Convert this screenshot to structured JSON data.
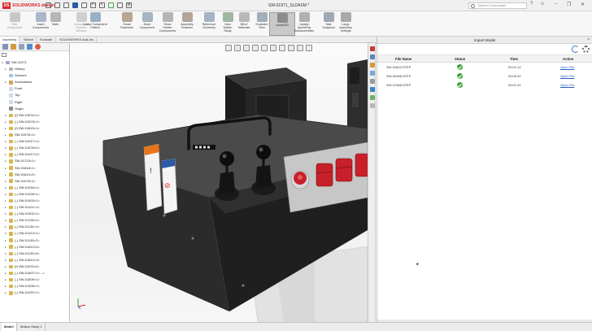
{
  "app": {
    "logo": "SOLIDWORKS design",
    "doc_title": "SW-01971_SLDASM *",
    "search_placeholder": "Search Commands"
  },
  "ribbon": [
    {
      "label": "Edit\nComponent",
      "dim": true,
      "icon": "edit-component-icon",
      "color": "#c7c7c7"
    },
    {
      "label": "Insert\nComponents",
      "icon": "insert-components-icon",
      "color": "#a9b7c9"
    },
    {
      "label": "Mate",
      "icon": "mate-icon",
      "color": "#b6b6b6"
    },
    {
      "label": "Component\nPreview\nWindow",
      "dim": true,
      "icon": "preview-window-icon",
      "color": "#cfcfcf"
    },
    {
      "label": "Linear Component\nPattern",
      "icon": "linear-pattern-icon",
      "color": "#9bb0c7"
    },
    {
      "label": "Smart\nFasteners",
      "icon": "smart-fasteners-icon",
      "color": "#b7a790"
    },
    {
      "label": "Move\nComponent",
      "icon": "move-component-icon",
      "color": "#a8b4c2"
    },
    {
      "label": "Show\nHidden\nComponents",
      "icon": "show-hidden-icon",
      "color": "#b5b5b5"
    },
    {
      "label": "Assembly\nFeatures",
      "icon": "assembly-features-icon",
      "color": "#b4a49a"
    },
    {
      "label": "Reference\nGeometry",
      "icon": "reference-geometry-icon",
      "color": "#a6b3c3"
    },
    {
      "label": "New\nMotion\nStudy",
      "icon": "motion-study-icon",
      "color": "#9fb6a3"
    },
    {
      "label": "Bill of\nMaterials",
      "icon": "bill-of-materials-icon",
      "color": "#b8b8b8"
    },
    {
      "label": "Exploded\nView",
      "icon": "exploded-view-icon",
      "color": "#a3aebb"
    },
    {
      "label": "Instant3D",
      "active": true,
      "icon": "instant3d-icon",
      "color": "#8c8c8c"
    },
    {
      "label": "Update\nSpeedPak\nSubassemblies",
      "icon": "speedpak-icon",
      "color": "#b0b0b0"
    },
    {
      "label": "Take\nSnapshot",
      "icon": "take-snapshot-icon",
      "color": "#a0a9b4"
    },
    {
      "label": "Large\nAssembly\nSettings",
      "icon": "large-assembly-icon",
      "color": "#a9a9a9"
    }
  ],
  "cmd_tabs": [
    "Assembly",
    "Sketch",
    "Evaluate",
    "SOLIDWORKS Add-Ins"
  ],
  "tree": [
    {
      "label": "SW-01971",
      "level": 0,
      "arrow": "▾",
      "icon": "assembly-icon",
      "color": "#9aa9bb"
    },
    {
      "label": "History",
      "level": 1,
      "arrow": "▸",
      "icon": "history-icon",
      "color": "#b0b0b0"
    },
    {
      "label": "Sensors",
      "level": 1,
      "arrow": "",
      "icon": "sensors-icon",
      "color": "#9ec3e0"
    },
    {
      "label": "Annotations",
      "level": 1,
      "arrow": "▸",
      "icon": "annotations-icon",
      "color": "#c9a65a"
    },
    {
      "label": "Front",
      "level": 1,
      "arrow": "",
      "icon": "plane-icon",
      "color": "#cfd9e6"
    },
    {
      "label": "Top",
      "level": 1,
      "arrow": "",
      "icon": "plane-icon",
      "color": "#cfd9e6"
    },
    {
      "label": "Right",
      "level": 1,
      "arrow": "",
      "icon": "plane-icon",
      "color": "#cfd9e6"
    },
    {
      "label": "Origin",
      "level": 1,
      "arrow": "",
      "icon": "origin-icon",
      "color": "#8c8c8c"
    },
    {
      "label": "(f) SW-01576<1>",
      "level": 1,
      "arrow": "▸",
      "icon": "part-icon",
      "color": "#d8b54a"
    },
    {
      "label": "(-) SW-01575<1>",
      "level": 1,
      "arrow": "▸",
      "icon": "part-icon",
      "color": "#d8b54a"
    },
    {
      "label": "(f) SW-01815<1>",
      "level": 1,
      "arrow": "▸",
      "icon": "part-icon",
      "color": "#d8b54a"
    },
    {
      "label": "SW-01578<1>",
      "level": 1,
      "arrow": "▸",
      "icon": "part-icon",
      "color": "#d8b54a"
    },
    {
      "label": "(-) SW-01917<1>",
      "level": 1,
      "arrow": "▸",
      "icon": "part-icon",
      "color": "#d8b54a"
    },
    {
      "label": "(-) SW-01576<2>",
      "level": 1,
      "arrow": "▸",
      "icon": "part-icon",
      "color": "#d8b54a"
    },
    {
      "label": "(-) SW-01917<2>",
      "level": 1,
      "arrow": "▸",
      "icon": "part-icon",
      "color": "#d8b54a"
    },
    {
      "label": "SW-01733<1>",
      "level": 1,
      "arrow": "▸",
      "icon": "part-icon",
      "color": "#d8b54a"
    },
    {
      "label": "SW-01818<1>",
      "level": 1,
      "arrow": "▸",
      "icon": "part-icon",
      "color": "#d8b54a"
    },
    {
      "label": "SW-01810<2>",
      "level": 1,
      "arrow": "▸",
      "icon": "part-icon",
      "color": "#d8b54a"
    },
    {
      "label": "SW-01576<1>",
      "level": 1,
      "arrow": "▸",
      "icon": "part-icon",
      "color": "#d8b54a"
    },
    {
      "label": "(-) SW-01934<1>",
      "level": 1,
      "arrow": "▸",
      "icon": "part-icon",
      "color": "#d8b54a"
    },
    {
      "label": "(-) SW-01939<1>",
      "level": 1,
      "arrow": "▸",
      "icon": "part-icon",
      "color": "#d8b54a"
    },
    {
      "label": "(-) SW-01903<1>",
      "level": 1,
      "arrow": "▸",
      "icon": "part-icon",
      "color": "#d8b54a"
    },
    {
      "label": "(-) SW-01121<1>",
      "level": 1,
      "arrow": "▸",
      "icon": "part-icon",
      "color": "#d8b54a"
    },
    {
      "label": "(-) SW-01402<1>",
      "level": 1,
      "arrow": "▸",
      "icon": "part-icon",
      "color": "#d8b54a"
    },
    {
      "label": "(-) SW-01128<1>",
      "level": 1,
      "arrow": "▸",
      "icon": "part-icon",
      "color": "#d8b54a"
    },
    {
      "label": "(-) SW-01130<1>",
      "level": 1,
      "arrow": "▸",
      "icon": "part-icon",
      "color": "#d8b54a"
    },
    {
      "label": "(-) SW-01412<1>",
      "level": 1,
      "arrow": "▸",
      "icon": "part-icon",
      "color": "#d8b54a"
    },
    {
      "label": "(-) SW-01130<2>",
      "level": 1,
      "arrow": "▸",
      "icon": "part-icon",
      "color": "#d8b54a"
    },
    {
      "label": "(-) SW-01812<4>",
      "level": 1,
      "arrow": "▸",
      "icon": "part-icon",
      "color": "#d8b54a"
    },
    {
      "label": "(-) SW-01130<3>",
      "level": 1,
      "arrow": "▸",
      "icon": "part-icon",
      "color": "#d8b54a"
    },
    {
      "label": "(-) SW-01812<3>",
      "level": 1,
      "arrow": "▸",
      "icon": "part-icon",
      "color": "#d8b54a"
    },
    {
      "label": "(f) SW-01575<2>",
      "level": 1,
      "arrow": "▸",
      "icon": "part-icon",
      "color": "#d8b54a"
    },
    {
      "label": "(-) SW-01807<1> -->",
      "level": 1,
      "arrow": "▸",
      "icon": "part-icon",
      "color": "#d8b54a"
    },
    {
      "label": "(-) SW-01809<1>",
      "level": 1,
      "arrow": "▸",
      "icon": "part-icon",
      "color": "#d8b54a"
    },
    {
      "label": "(-) SW-01906<1>",
      "level": 1,
      "arrow": "▸",
      "icon": "part-icon",
      "color": "#d8b54a"
    },
    {
      "label": "(-) SW-01937<1>",
      "level": 1,
      "arrow": "▸",
      "icon": "part-icon",
      "color": "#d8b54a"
    }
  ],
  "bottom_tabs": [
    "Model",
    "Motion Study 1"
  ],
  "import_panel": {
    "title": "Import Model",
    "columns": [
      "File Name",
      "Status",
      "Time",
      "Action"
    ],
    "rows": [
      {
        "file": "SW-01603.STEP",
        "status": "ok",
        "time": "00:01:14",
        "action": "Open File"
      },
      {
        "file": "SW-02488.STEP",
        "status": "ok",
        "time": "00:00:42",
        "action": "Open File"
      },
      {
        "file": "SW-27488.STEP",
        "status": "ok",
        "time": "00:01:31",
        "action": "Open File"
      }
    ]
  },
  "viewport": {
    "label_warning": "!",
    "label_prohibit": "⊘"
  },
  "colors": {
    "brand": "#d9262d",
    "link": "#2060c0",
    "status_ok": "#3aa13a",
    "part_body": "#2b2b2b",
    "button_red": "#c8202a"
  }
}
